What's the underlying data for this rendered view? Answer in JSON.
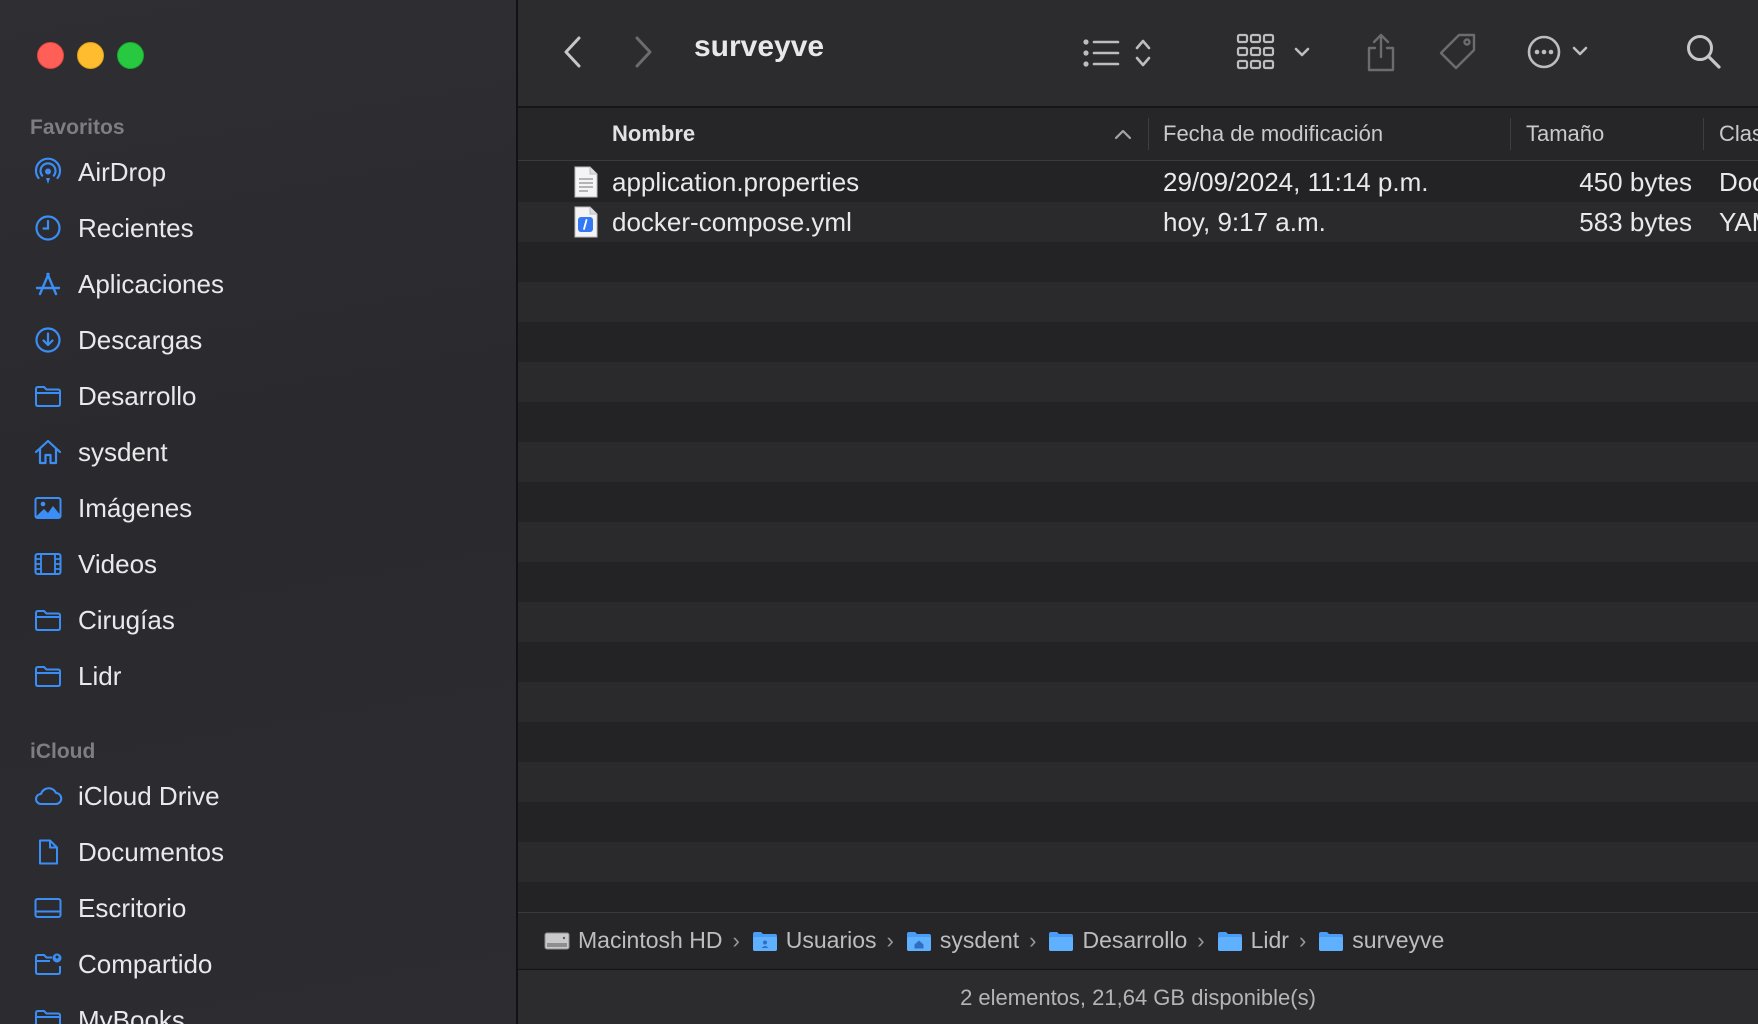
{
  "window": {
    "title": "surveyve"
  },
  "sidebar": {
    "sections": [
      {
        "title": "Favoritos",
        "items": [
          {
            "label": "AirDrop",
            "icon": "airdrop-icon"
          },
          {
            "label": "Recientes",
            "icon": "clock-icon"
          },
          {
            "label": "Aplicaciones",
            "icon": "applications-icon"
          },
          {
            "label": "Descargas",
            "icon": "download-icon"
          },
          {
            "label": "Desarrollo",
            "icon": "folder-icon"
          },
          {
            "label": "sysdent",
            "icon": "home-icon"
          },
          {
            "label": "Imágenes",
            "icon": "photo-icon"
          },
          {
            "label": "Videos",
            "icon": "film-icon"
          },
          {
            "label": "Cirugías",
            "icon": "folder-icon"
          },
          {
            "label": "Lidr",
            "icon": "folder-icon"
          }
        ]
      },
      {
        "title": "iCloud",
        "items": [
          {
            "label": "iCloud Drive",
            "icon": "cloud-icon"
          },
          {
            "label": "Documentos",
            "icon": "document-icon"
          },
          {
            "label": "Escritorio",
            "icon": "desktop-icon"
          },
          {
            "label": "Compartido",
            "icon": "shared-folder-icon"
          },
          {
            "label": "MyBooks",
            "icon": "folder-icon"
          }
        ]
      }
    ]
  },
  "columns": {
    "name": "Nombre",
    "date": "Fecha de modificación",
    "size": "Tamaño",
    "kind": "Clase"
  },
  "files": [
    {
      "name": "application.properties",
      "date": "29/09/2024, 11:14 p.m.",
      "size": "450 bytes",
      "kind": "Documento",
      "icon": "text-document-icon"
    },
    {
      "name": "docker-compose.yml",
      "date": "hoy, 9:17 a.m.",
      "size": "583 bytes",
      "kind": "YAML",
      "icon": "yaml-document-icon"
    }
  ],
  "pathbar": {
    "crumbs": [
      "Macintosh HD",
      "Usuarios",
      "sysdent",
      "Desarrollo",
      "Lidr",
      "surveyve"
    ]
  },
  "status": {
    "text": "2 elementos, 21,64 GB disponible(s)"
  },
  "colors": {
    "accent": "#3a8ef6",
    "folder": "#4a9cf5",
    "sidebar_text": "#e9e9ec"
  }
}
